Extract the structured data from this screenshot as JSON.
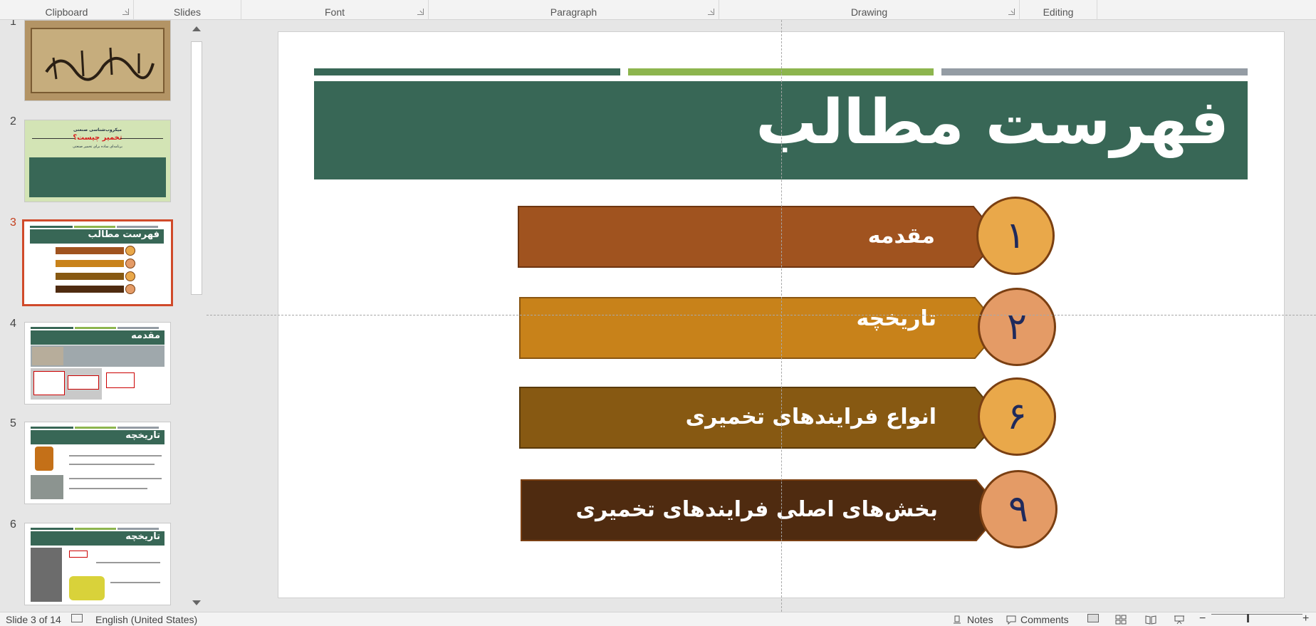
{
  "ribbon": {
    "groups": [
      "Clipboard",
      "Slides",
      "Font",
      "Paragraph",
      "Drawing",
      "Editing"
    ]
  },
  "thumbnails": {
    "numbers": [
      "1",
      "2",
      "3",
      "4",
      "5",
      "6"
    ],
    "slide2": {
      "top": "میکروب‌شناسی صنعتی",
      "title": "تخمیر چیست؟",
      "sub": "برنامه‌ای ساده برای تخمیر صنعتی"
    },
    "slide3_title": "فهرست مطالب",
    "slide4_title": "مقدمه",
    "slide5_title": "تاریخچه",
    "slide6_title": "تاریخچه"
  },
  "slide": {
    "title": "فهرست مطالب",
    "colors": {
      "dark_green": "#386756",
      "light_green": "#8db54e",
      "gray": "#949ca4"
    },
    "items": [
      {
        "number": "١",
        "label": "مقدمه",
        "banner_color": "#a0531f",
        "circle_color": "#e9a84a"
      },
      {
        "number": "٢",
        "label": "تاریخچه",
        "banner_color": "#c8821a",
        "circle_color": "#e49b66"
      },
      {
        "number": "۶",
        "label": "انواع فرایندهای تخمیری",
        "banner_color": "#875912",
        "circle_color": "#e9a84a"
      },
      {
        "number": "٩",
        "label": "بخش‌های اصلی فرایندهای تخمیری",
        "banner_color": "#4f2b10",
        "circle_color": "#e49b66"
      }
    ]
  },
  "statusbar": {
    "slide_info": "Slide 3 of 14",
    "language": "English (United States)",
    "notes": "Notes",
    "comments": "Comments"
  }
}
